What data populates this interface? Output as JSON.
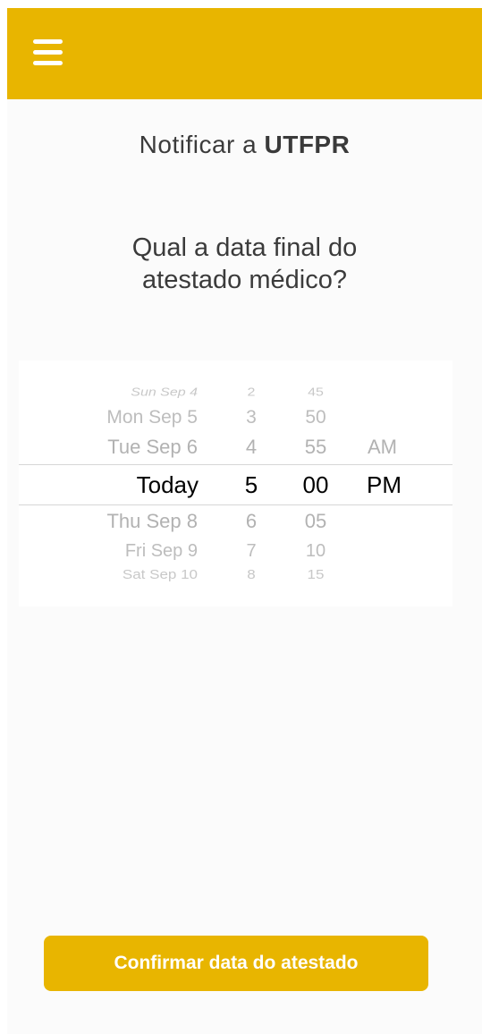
{
  "header": {
    "menu_icon": "hamburger-menu-icon",
    "background_color": "#e8b500"
  },
  "title": {
    "prefix": "Notificar a ",
    "org": "UTFPR"
  },
  "question": "Qual a data final do atestado médico?",
  "picker": {
    "dates": [
      "Sun Sep 4",
      "Mon Sep 5",
      "Tue Sep 6",
      "Today",
      "Thu Sep 8",
      "Fri Sep 9",
      "Sat Sep 10"
    ],
    "hours": [
      "2",
      "3",
      "4",
      "5",
      "6",
      "7",
      "8"
    ],
    "minutes": [
      "45",
      "50",
      "55",
      "00",
      "05",
      "10",
      "15"
    ],
    "periods": [
      "AM",
      "PM"
    ],
    "selected": {
      "date": "Today",
      "hour": "5",
      "minute": "00",
      "period": "PM"
    }
  },
  "confirm_button": {
    "label": "Confirmar data do atestado",
    "color": "#e8b500"
  }
}
